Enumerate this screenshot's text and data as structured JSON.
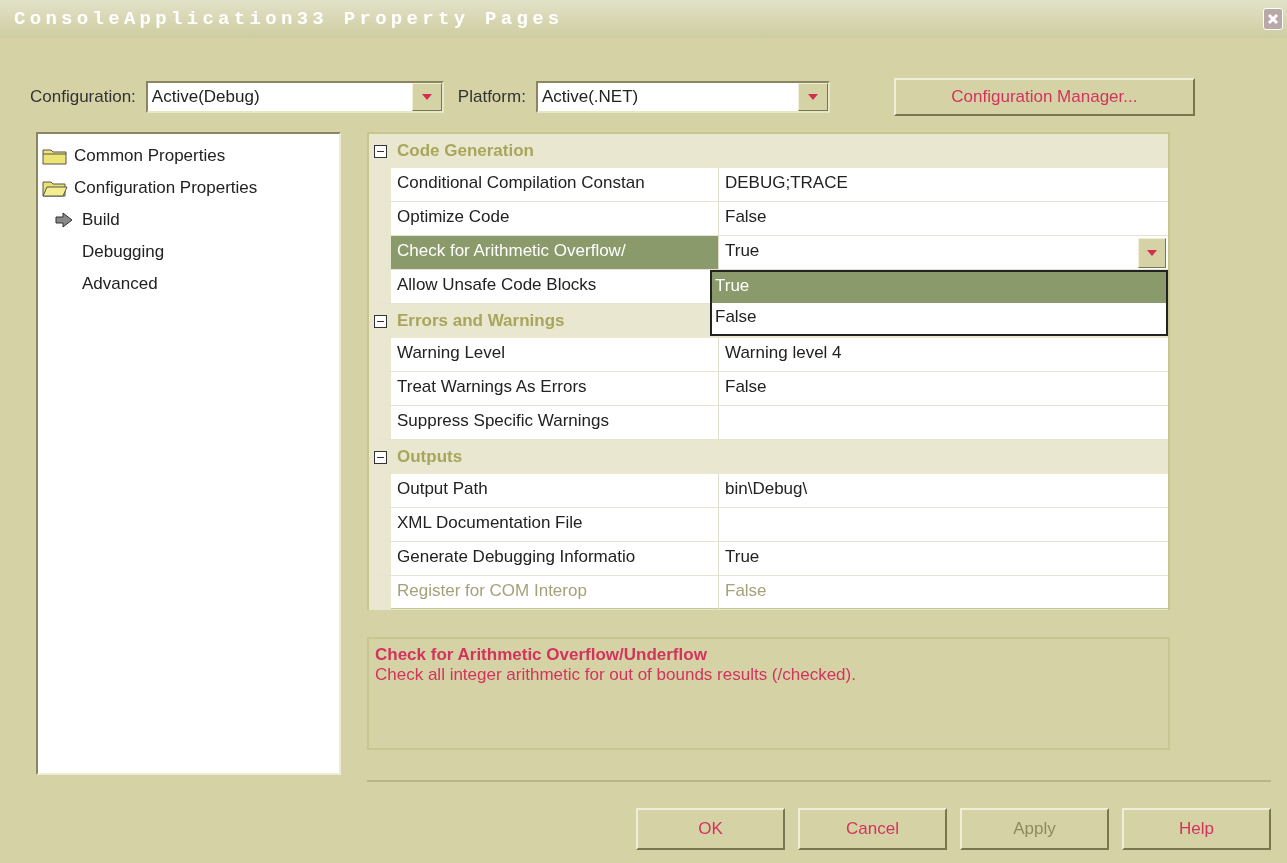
{
  "window": {
    "title": "ConsoleApplication33 Property Pages"
  },
  "configuration": {
    "label": "Configuration:",
    "value": "Active(Debug)"
  },
  "platform": {
    "label": "Platform:",
    "value": "Active(.NET)"
  },
  "configuration_manager_button": "Configuration Manager...",
  "tree": [
    {
      "label": "Common Properties",
      "kind": "folder",
      "expanded": false
    },
    {
      "label": "Configuration Properties",
      "kind": "folder",
      "expanded": true,
      "children": [
        {
          "label": "Build",
          "kind": "page",
          "selected": true
        },
        {
          "label": "Debugging",
          "kind": "page",
          "selected": false
        },
        {
          "label": "Advanced",
          "kind": "page",
          "selected": false
        }
      ]
    }
  ],
  "property_grid": {
    "categories": [
      {
        "name": "Code Generation",
        "expanded": true,
        "properties": [
          {
            "name": "Conditional Compilation Constan",
            "value": "DEBUG;TRACE",
            "selected": false,
            "disabled": false
          },
          {
            "name": "Optimize Code",
            "value": "False",
            "selected": false,
            "disabled": false
          },
          {
            "name": "Check for Arithmetic Overflow/",
            "value": "True",
            "selected": true,
            "disabled": false,
            "dropdown": {
              "options": [
                {
                  "label": "True",
                  "selected": true
                },
                {
                  "label": "False",
                  "selected": false
                }
              ]
            }
          },
          {
            "name": "Allow Unsafe Code Blocks",
            "selected": false,
            "disabled": false
          }
        ]
      },
      {
        "name": "Errors and Warnings",
        "expanded": true,
        "properties": [
          {
            "name": "Warning Level",
            "value": "Warning level 4",
            "selected": false,
            "disabled": false
          },
          {
            "name": "Treat Warnings As Errors",
            "value": "False",
            "selected": false,
            "disabled": false
          },
          {
            "name": "Suppress Specific Warnings",
            "selected": false,
            "disabled": false
          }
        ]
      },
      {
        "name": "Outputs",
        "expanded": true,
        "properties": [
          {
            "name": "Output Path",
            "value": "bin\\Debug\\",
            "selected": false,
            "disabled": false
          },
          {
            "name": "XML Documentation File",
            "selected": false,
            "disabled": false
          },
          {
            "name": "Generate Debugging Informatio",
            "value": "True",
            "selected": false,
            "disabled": false
          },
          {
            "name": "Register for COM Interop",
            "value": "False",
            "selected": false,
            "disabled": true
          }
        ]
      }
    ]
  },
  "description": {
    "title": "Check for Arithmetic Overflow/Underflow",
    "text": "Check all integer arithmetic for out of bounds results (/checked)."
  },
  "buttons": [
    {
      "label": "OK",
      "disabled": false
    },
    {
      "label": "Cancel",
      "disabled": false
    },
    {
      "label": "Apply",
      "disabled": true
    },
    {
      "label": "Help",
      "disabled": false
    }
  ]
}
